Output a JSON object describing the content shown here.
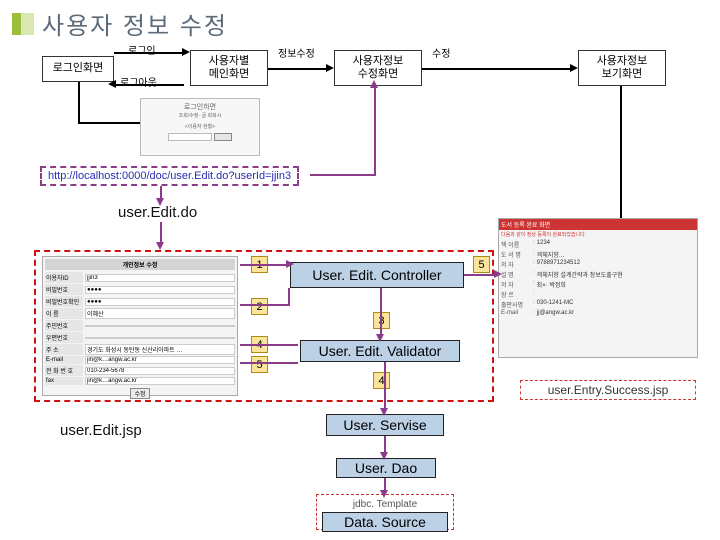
{
  "title": "사용자 정보 수정",
  "flow": {
    "login_screen": "로그인화면",
    "login": "로그인",
    "logout": "로그아웃",
    "user_main": "사용자별\n메인화면",
    "info_edit": "정보수정",
    "user_edit_screen": "사용자정보\n수정화면",
    "edit_action": "수정",
    "user_view_screen": "사용자정보\n보기화면"
  },
  "url": "http://localhost:0000/doc/user.Edit.do?userId=jjin3",
  "stages": {
    "user_edit_do": "user.Edit.do",
    "user_edit_jsp": "user.Edit.jsp",
    "success_jsp": "user.Entry.Success.jsp"
  },
  "components": {
    "controller": "User. Edit. Controller",
    "validator": "User. Edit. Validator",
    "service": "User. Servise",
    "dao": "User. Dao",
    "jdbc": "jdbc. Template",
    "datasource": "Data. Source"
  },
  "badges": [
    "1",
    "2",
    "3",
    "4",
    "5",
    "5",
    "4"
  ],
  "login_mock": {
    "title": "로그인하면",
    "sub1": "조회/수정· 글 회복시",
    "sub2": "<이용자 현황>"
  },
  "form_mock": {
    "title": "개인정보 수정",
    "rows": [
      {
        "label": "이용자ID",
        "value": "jjin3"
      },
      {
        "label": "비밀번호",
        "value": "●●●●"
      },
      {
        "label": "비밀번호확인",
        "value": "●●●●"
      },
      {
        "label": "이 름",
        "value": "이혜산"
      },
      {
        "label": "주민번호",
        "value": ""
      },
      {
        "label": "우편번호",
        "value": ""
      },
      {
        "label": "주 소",
        "value": "경기도 화성시 동탄동 신산리아파트 …"
      },
      {
        "label": "E-mail",
        "value": "jin@k…angw.ac.kr"
      },
      {
        "label": "전 화 번 호",
        "value": "010-234-5678"
      },
      {
        "label": "fax",
        "value": "jin@k…angw.ac.kr"
      }
    ],
    "submit": "수정"
  },
  "success_mock": {
    "bar": "도서 등록 완료 화면",
    "sub": "다음과 같이 정상 등록이 완료되었습니다.",
    "lines": [
      {
        "k": "책 이름",
        "v": "1234"
      },
      {
        "k": "도 서 명",
        "v": "객체지향…"
      },
      {
        "k": "저 자",
        "v": "9788971234512"
      },
      {
        "k": "설 명",
        "v": "객체지향 설계간략과 정보도출구현"
      },
      {
        "k": "저 자",
        "v": "최×· 박정희"
      },
      {
        "k": "장 르",
        "v": ""
      },
      {
        "k": "출판사명",
        "v": "030-1241-MC"
      },
      {
        "k": "E-mail",
        "v": "jj@angw.ac.kr"
      }
    ]
  }
}
